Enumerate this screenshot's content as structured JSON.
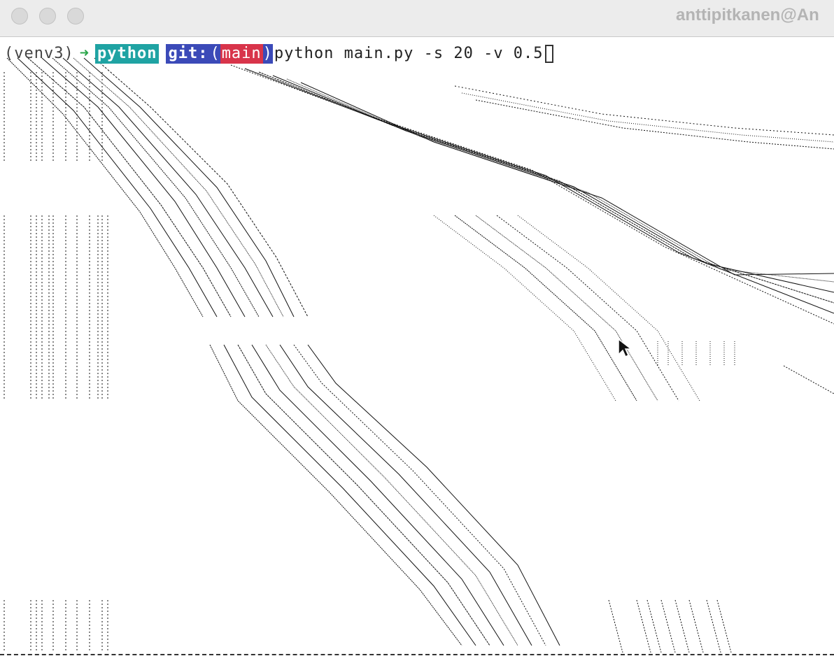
{
  "window": {
    "title": "anttipitkanen@An"
  },
  "terminal": {
    "prompt": {
      "venv": "(venv3)",
      "arrow": "➜",
      "directory": "python",
      "git_label": "git:",
      "paren_open": "(",
      "branch": "main",
      "paren_close": ")",
      "command": "python main.py -s 20 -v 0.5"
    },
    "colors": {
      "arrow": "#2aa54a",
      "directory_bg": "#1fa3a3",
      "git_bg": "#3b4ab8",
      "branch_bg": "#d8344a",
      "ink": "#111111"
    }
  },
  "icons": {
    "pointer": "mouse-pointer-icon"
  }
}
